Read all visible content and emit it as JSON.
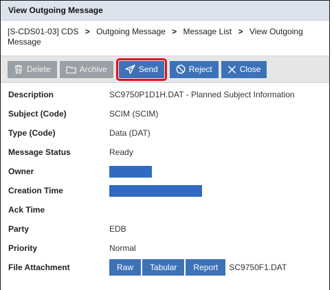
{
  "window": {
    "title": "View Outgoing Message"
  },
  "breadcrumb": {
    "prefix": "[S-CDS01-03]",
    "items": [
      "CDS",
      "Outgoing Message",
      "Message List",
      "View Outgoing Message"
    ]
  },
  "toolbar": {
    "delete_label": "Delete",
    "archive_label": "Archive",
    "send_label": "Send",
    "reject_label": "Reject",
    "close_label": "Close"
  },
  "details": {
    "description": {
      "label": "Description",
      "value": "SC9750P1D1H.DAT - Planned Subject Information"
    },
    "subject": {
      "label": "Subject (Code)",
      "value": "SCIM (SCIM)"
    },
    "type": {
      "label": "Type (Code)",
      "value": "Data (DAT)"
    },
    "status": {
      "label": "Message Status",
      "value": "Ready"
    },
    "owner": {
      "label": "Owner"
    },
    "creation_time": {
      "label": "Creation Time"
    },
    "ack_time": {
      "label": "Ack Time",
      "value": ""
    },
    "party": {
      "label": "Party",
      "value": "EDB"
    },
    "priority": {
      "label": "Priority",
      "value": "Normal"
    },
    "file_attachment": {
      "label": "File Attachment",
      "raw_label": "Raw",
      "tabular_label": "Tabular",
      "report_label": "Report",
      "filename": "SC9750F1.DAT"
    }
  },
  "colors": {
    "primary_button": "#3d72b7",
    "disabled_button": "#9aa0a6",
    "highlight": "#e0101a",
    "redaction": "#2f6bc2"
  }
}
